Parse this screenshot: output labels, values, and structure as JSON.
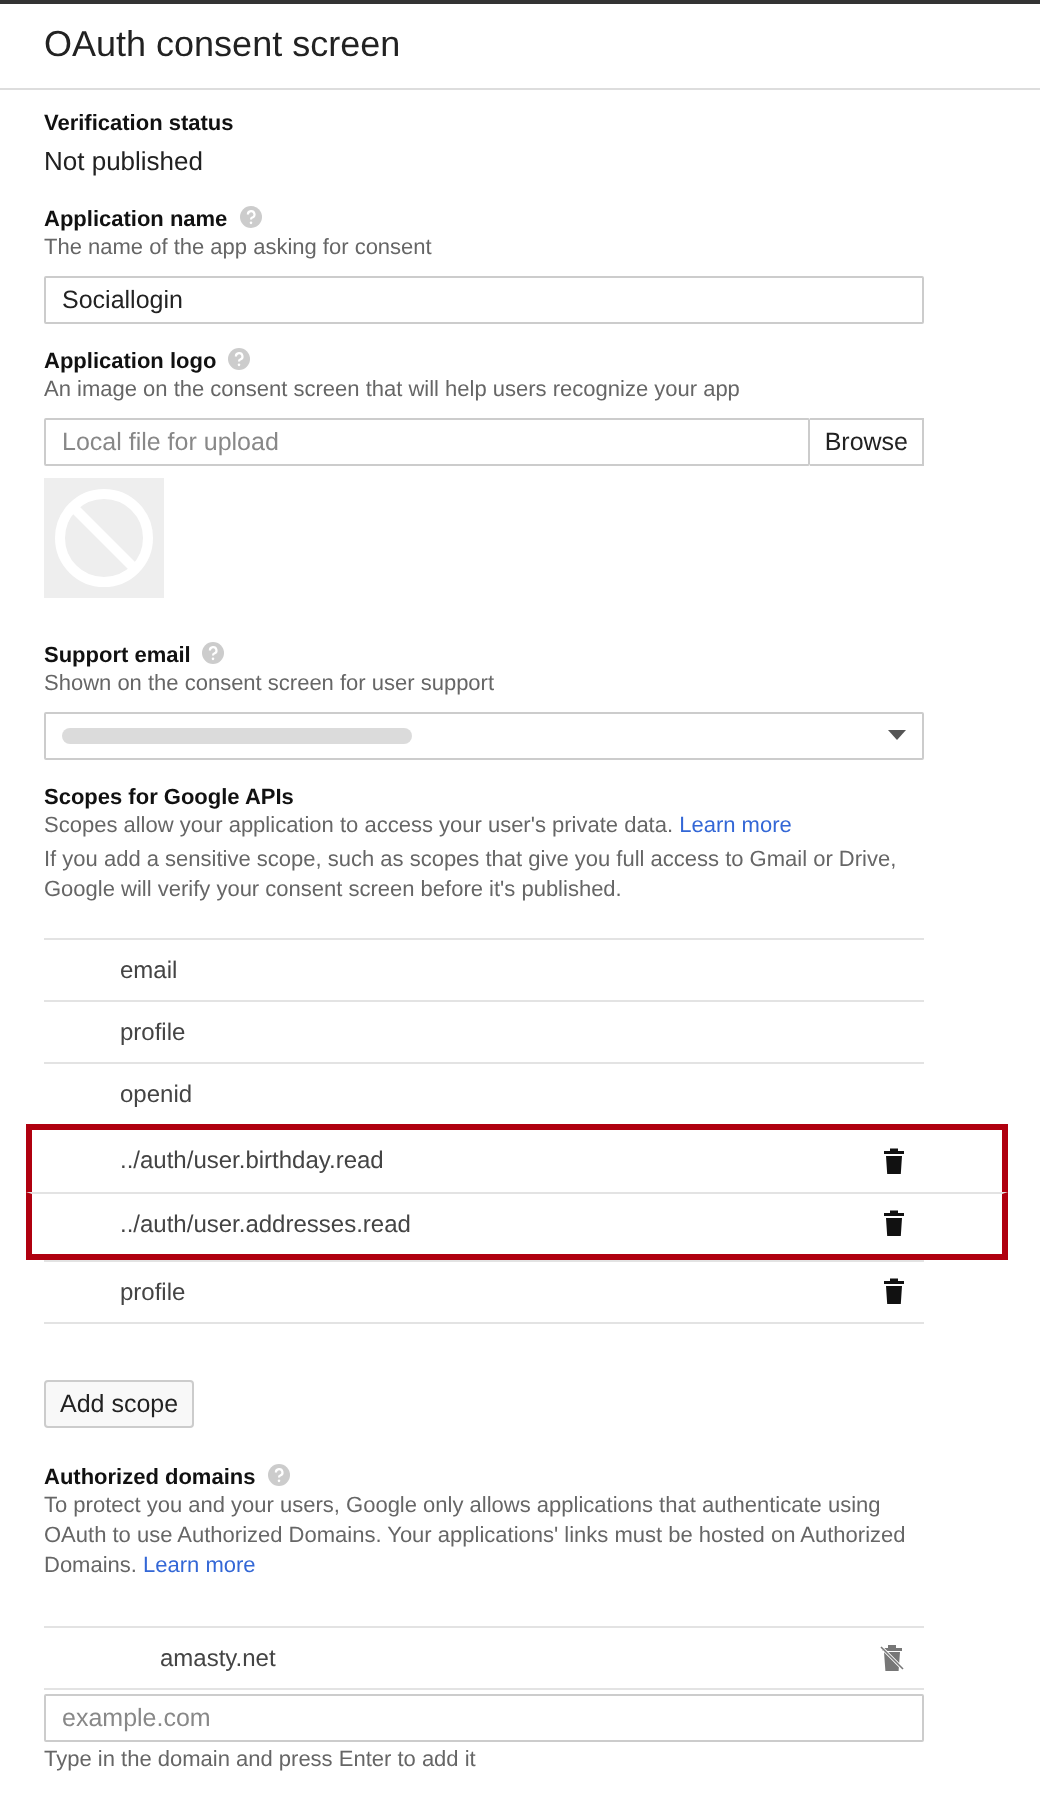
{
  "header": {
    "title": "OAuth consent screen"
  },
  "verification": {
    "label": "Verification status",
    "value": "Not published"
  },
  "app_name": {
    "label": "Application name",
    "hint": "The name of the app asking for consent",
    "value": "Sociallogin"
  },
  "app_logo": {
    "label": "Application logo",
    "hint": "An image on the consent screen that will help users recognize your app",
    "placeholder": "Local file for upload",
    "button": "Browse"
  },
  "support_email": {
    "label": "Support email",
    "hint": "Shown on the consent screen for user support"
  },
  "scopes": {
    "label": "Scopes for Google APIs",
    "hint": "Scopes allow your application to access your user's private data.",
    "link": "Learn more",
    "note": "If you add a sensitive scope, such as scopes that give you full access to Gmail or Drive, Google will verify your consent screen before it's published.",
    "items": [
      {
        "name": "email",
        "removable": false,
        "highlighted": false
      },
      {
        "name": "profile",
        "removable": false,
        "highlighted": false
      },
      {
        "name": "openid",
        "removable": false,
        "highlighted": false
      },
      {
        "name": "../auth/user.birthday.read",
        "removable": true,
        "highlighted": true
      },
      {
        "name": "../auth/user.addresses.read",
        "removable": true,
        "highlighted": true
      },
      {
        "name": "profile",
        "removable": true,
        "highlighted": false
      }
    ],
    "add_button": "Add scope"
  },
  "domains": {
    "label": "Authorized domains",
    "hint": "To protect you and your users, Google only allows applications that authenticate using OAuth to use Authorized Domains. Your applications' links must be hosted on Authorized Domains.",
    "link": "Learn more",
    "items": [
      {
        "name": "amasty.net",
        "delete_disabled": true
      }
    ],
    "placeholder": "example.com",
    "footer": "Type in the domain and press Enter to add it"
  }
}
